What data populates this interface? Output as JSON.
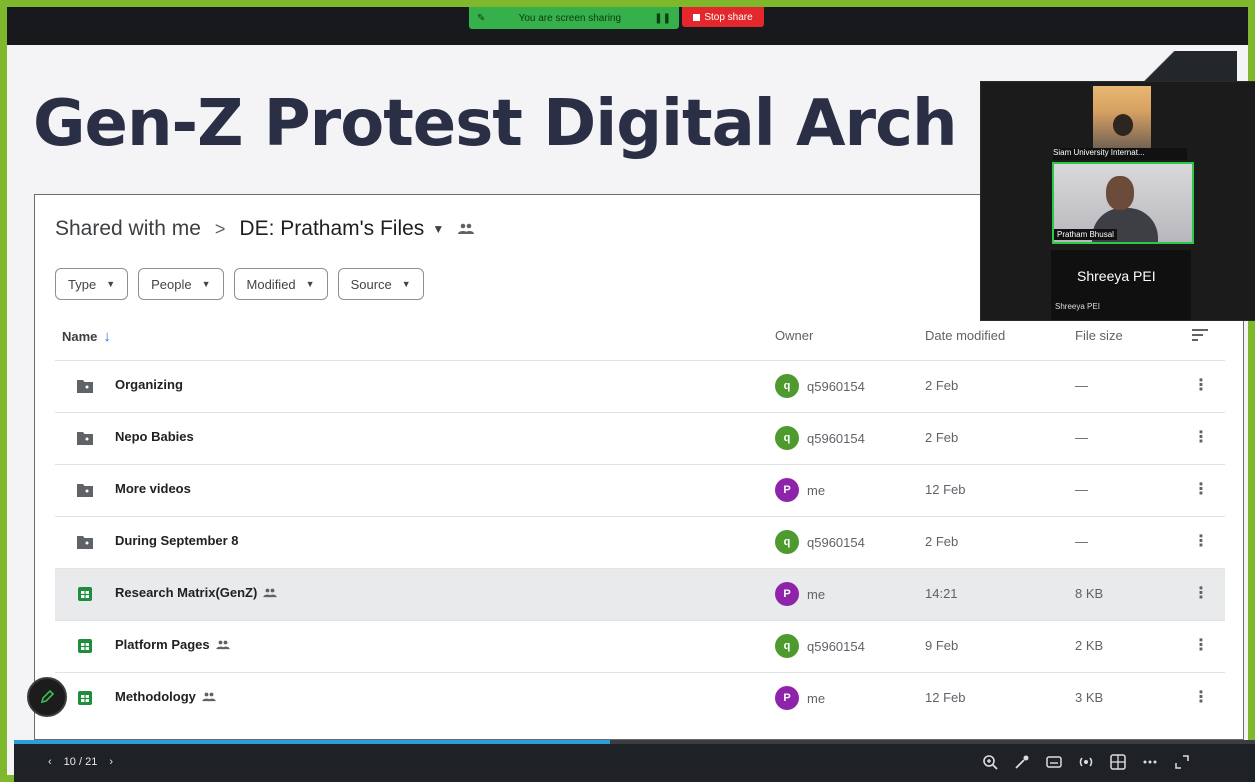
{
  "share_bar": {
    "sharing_label": "You are screen sharing",
    "stop_label": "Stop share"
  },
  "slide": {
    "title": "Gen-Z Protest Digital Arch"
  },
  "breadcrumb": {
    "parent": "Shared with me",
    "separator": ">",
    "current": "DE: Pratham's Files"
  },
  "filters": [
    "Type",
    "People",
    "Modified",
    "Source"
  ],
  "columns": {
    "name": "Name",
    "owner": "Owner",
    "date": "Date modified",
    "size": "File size"
  },
  "files": [
    {
      "name": "Organizing",
      "type": "shared-folder-icon",
      "owner": "q5960154",
      "owner_initial": "q",
      "avatar_color": "#4e9a2f",
      "date": "2 Feb",
      "size": "—",
      "shared": false,
      "selected": false
    },
    {
      "name": "Nepo Babies",
      "type": "shared-folder-icon",
      "owner": "q5960154",
      "owner_initial": "q",
      "avatar_color": "#4e9a2f",
      "date": "2 Feb",
      "size": "—",
      "shared": false,
      "selected": false
    },
    {
      "name": "More videos",
      "type": "shared-folder-icon",
      "owner": "me",
      "owner_initial": "P",
      "avatar_color": "#8e24aa",
      "date": "12 Feb",
      "size": "—",
      "shared": false,
      "selected": false
    },
    {
      "name": "During September 8",
      "type": "shared-folder-icon",
      "owner": "q5960154",
      "owner_initial": "q",
      "avatar_color": "#4e9a2f",
      "date": "2 Feb",
      "size": "—",
      "shared": false,
      "selected": false
    },
    {
      "name": "Research Matrix(GenZ)",
      "type": "sheets-icon",
      "owner": "me",
      "owner_initial": "P",
      "avatar_color": "#8e24aa",
      "date": "14:21",
      "size": "8 KB",
      "shared": true,
      "selected": true
    },
    {
      "name": "Platform Pages",
      "type": "sheets-icon",
      "owner": "q5960154",
      "owner_initial": "q",
      "avatar_color": "#4e9a2f",
      "date": "9 Feb",
      "size": "2 KB",
      "shared": true,
      "selected": false
    },
    {
      "name": "Methodology",
      "type": "sheets-icon",
      "owner": "me",
      "owner_initial": "P",
      "avatar_color": "#8e24aa",
      "date": "12 Feb",
      "size": "3 KB",
      "shared": true,
      "selected": false
    }
  ],
  "video": {
    "participant1_label": "Siam University Internat...",
    "participant2_label": "Pratham Bhusal",
    "speaker_name": "Shreeya PEI",
    "speaker_small": "Shreeya PEI"
  },
  "presentation": {
    "page_indicator": "10 / 21",
    "progress": 0.48
  },
  "colors": {
    "frame": "#7fb82d",
    "accent_blue": "#1a73e8",
    "sheets_green": "#1e8e3e"
  }
}
